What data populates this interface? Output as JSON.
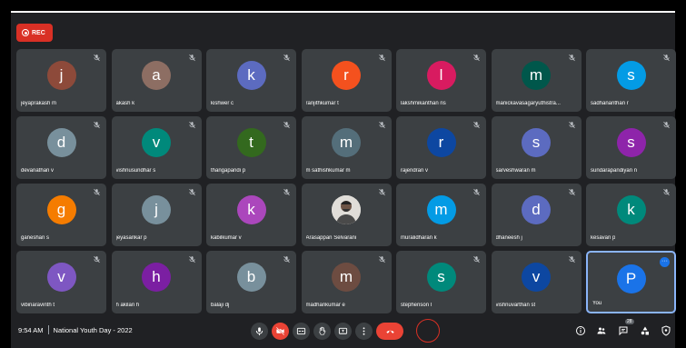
{
  "recording": {
    "label": "REC"
  },
  "meeting": {
    "time": "9:54 AM",
    "title": "National Youth Day - 2022"
  },
  "participant_count": "28",
  "participants": [
    {
      "name": "jeyaprakash m",
      "initial": "j",
      "color": "#8d4a3a",
      "muted": true
    },
    {
      "name": "akash k",
      "initial": "a",
      "color": "#8d6e63",
      "muted": true
    },
    {
      "name": "kishwer c",
      "initial": "k",
      "color": "#5c6bc0",
      "muted": true
    },
    {
      "name": "ranjithkumar t",
      "initial": "r",
      "color": "#f4511e",
      "muted": true
    },
    {
      "name": "lakshmikanthan ns",
      "initial": "l",
      "color": "#d81b60",
      "muted": true
    },
    {
      "name": "manickavasagaryuthistra...",
      "initial": "m",
      "color": "#00574b",
      "muted": true
    },
    {
      "name": "sadhananthan r",
      "initial": "s",
      "color": "#039be5",
      "muted": true
    },
    {
      "name": "devanathan v",
      "initial": "d",
      "color": "#78909c",
      "muted": true
    },
    {
      "name": "vishnusundhar s",
      "initial": "v",
      "color": "#00897b",
      "muted": true
    },
    {
      "name": "thangapandi p",
      "initial": "t",
      "color": "#33691e",
      "muted": true
    },
    {
      "name": "m sathishkumar m",
      "initial": "m",
      "color": "#546e7a",
      "muted": true
    },
    {
      "name": "rajendran v",
      "initial": "r",
      "color": "#0d47a1",
      "muted": true
    },
    {
      "name": "sarveshwaran m",
      "initial": "s",
      "color": "#5c6bc0",
      "muted": true
    },
    {
      "name": "sundarapandiyan n",
      "initial": "s",
      "color": "#8e24aa",
      "muted": true
    },
    {
      "name": "ganeshan s",
      "initial": "g",
      "color": "#f57c00",
      "muted": true
    },
    {
      "name": "jeyasankar p",
      "initial": "j",
      "color": "#78909c",
      "muted": true
    },
    {
      "name": "kabilkumar v",
      "initial": "k",
      "color": "#ab47bc",
      "muted": true
    },
    {
      "name": "Arasappan Selvarani",
      "initial": "",
      "color": "#e8e8e8",
      "photo": true,
      "muted": true
    },
    {
      "name": "muralidharan k",
      "initial": "m",
      "color": "#039be5",
      "muted": true
    },
    {
      "name": "dhaneesh j",
      "initial": "d",
      "color": "#5c6bc0",
      "muted": true
    },
    {
      "name": "kesavan p",
      "initial": "k",
      "color": "#00897b",
      "muted": true
    },
    {
      "name": "vibinaravinth t",
      "initial": "v",
      "color": "#7e57c2",
      "muted": true
    },
    {
      "name": "h akilan h",
      "initial": "h",
      "color": "#7b1fa2",
      "muted": true
    },
    {
      "name": "balaji dj",
      "initial": "b",
      "color": "#78909c",
      "muted": true
    },
    {
      "name": "madhankumar e",
      "initial": "m",
      "color": "#6d4c41",
      "muted": true
    },
    {
      "name": "stephenson l",
      "initial": "s",
      "color": "#00897b",
      "muted": true
    },
    {
      "name": "vishnuvarthan st",
      "initial": "v",
      "color": "#0d47a1",
      "muted": true
    },
    {
      "name": "You",
      "initial": "P",
      "color": "#1a73e8",
      "muted": false,
      "self": true
    }
  ],
  "controls": {
    "mic": "mic-icon",
    "camera": "camera-off-icon",
    "captions": "captions-icon",
    "raise_hand": "raise-hand-icon",
    "present": "present-screen-icon",
    "more": "more-options-icon",
    "leave": "leave-call-icon"
  },
  "right_controls": [
    "info-icon",
    "people-icon",
    "chat-icon",
    "activities-icon",
    "host-controls-icon"
  ]
}
